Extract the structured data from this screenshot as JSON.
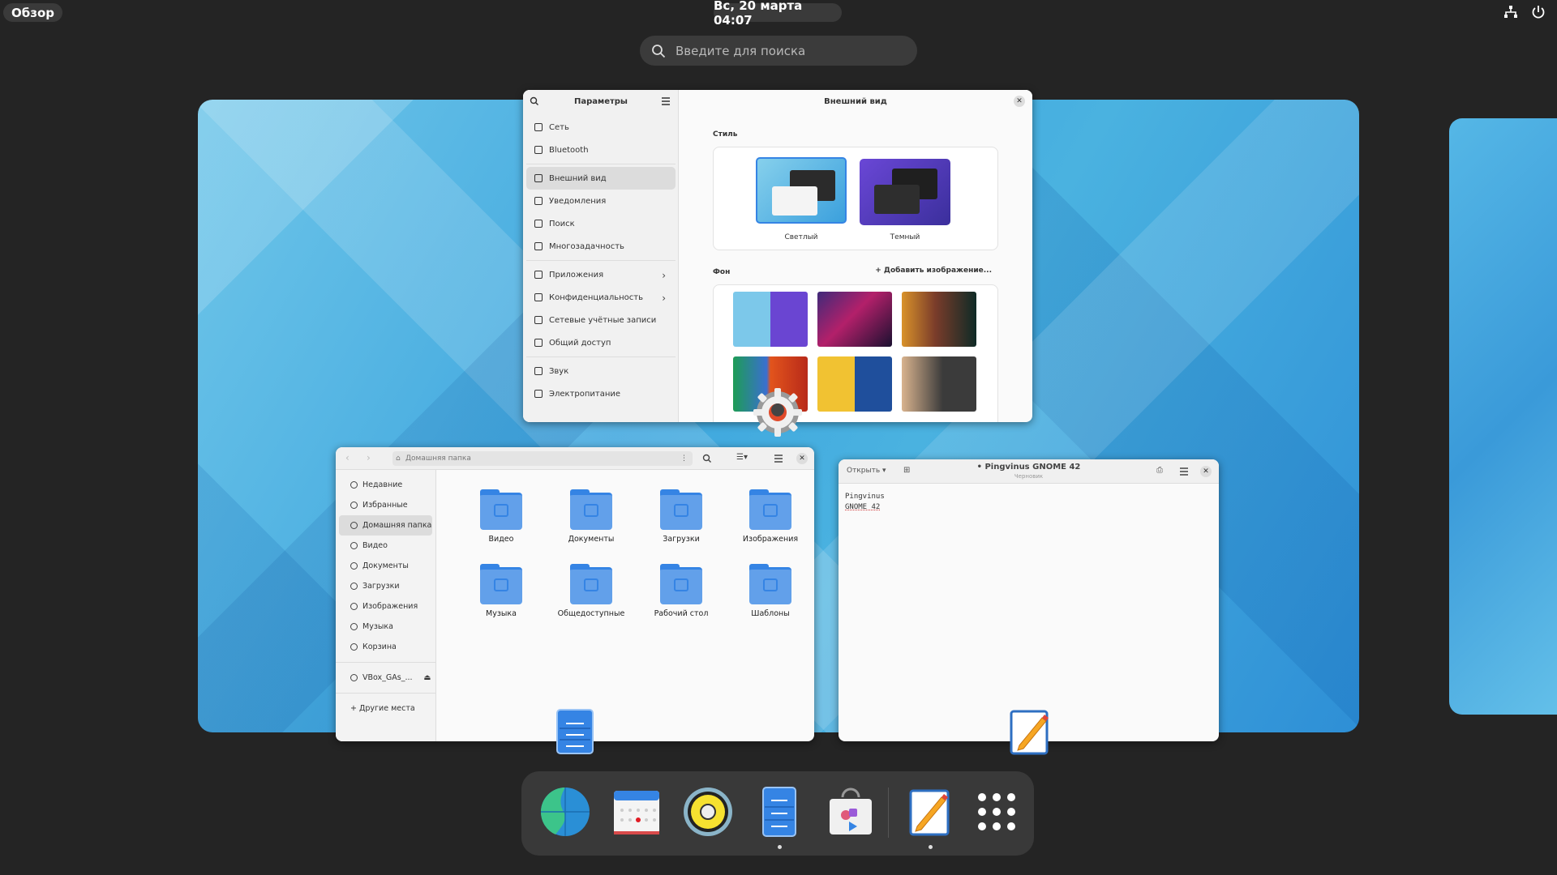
{
  "topbar": {
    "activities": "Обзор",
    "clock": "Вс, 20 марта  04:07"
  },
  "search": {
    "placeholder": "Введите для поиска"
  },
  "settings": {
    "sidebar_title": "Параметры",
    "panel_title": "Внешний вид",
    "items": [
      {
        "label": "Сеть"
      },
      {
        "label": "Bluetooth"
      },
      {
        "label": "Внешний вид"
      },
      {
        "label": "Уведомления"
      },
      {
        "label": "Поиск"
      },
      {
        "label": "Многозадачность"
      },
      {
        "label": "Приложения"
      },
      {
        "label": "Конфиденциальность"
      },
      {
        "label": "Сетевые учётные записи"
      },
      {
        "label": "Общий доступ"
      },
      {
        "label": "Звук"
      },
      {
        "label": "Электропитание"
      }
    ],
    "style_title": "Стиль",
    "light_label": "Светлый",
    "dark_label": "Темный",
    "bg_title": "Фон",
    "add_image": "+ Добавить изображение..."
  },
  "files": {
    "path": "Домашняя папка",
    "sidebar": [
      {
        "label": "Недавние"
      },
      {
        "label": "Избранные"
      },
      {
        "label": "Домашняя папка"
      },
      {
        "label": "Видео"
      },
      {
        "label": "Документы"
      },
      {
        "label": "Загрузки"
      },
      {
        "label": "Изображения"
      },
      {
        "label": "Музыка"
      },
      {
        "label": "Корзина"
      },
      {
        "label": "VBox_GAs_..."
      },
      {
        "label": "+ Другие места"
      }
    ],
    "folders": [
      {
        "label": "Видео"
      },
      {
        "label": "Документы"
      },
      {
        "label": "Загрузки"
      },
      {
        "label": "Изображения"
      },
      {
        "label": "Музыка"
      },
      {
        "label": "Общедоступные"
      },
      {
        "label": "Рабочий стол"
      },
      {
        "label": "Шаблоны"
      }
    ]
  },
  "editor": {
    "open_label": "Открыть",
    "title": "• Pingvinus GNOME 42",
    "subtitle": "Черновик",
    "line1": "Pingvinus",
    "line2": "GNOME 42"
  },
  "colors": {
    "accent": "#3584e4",
    "folder": "#62a0ea",
    "panel": "#242424"
  }
}
